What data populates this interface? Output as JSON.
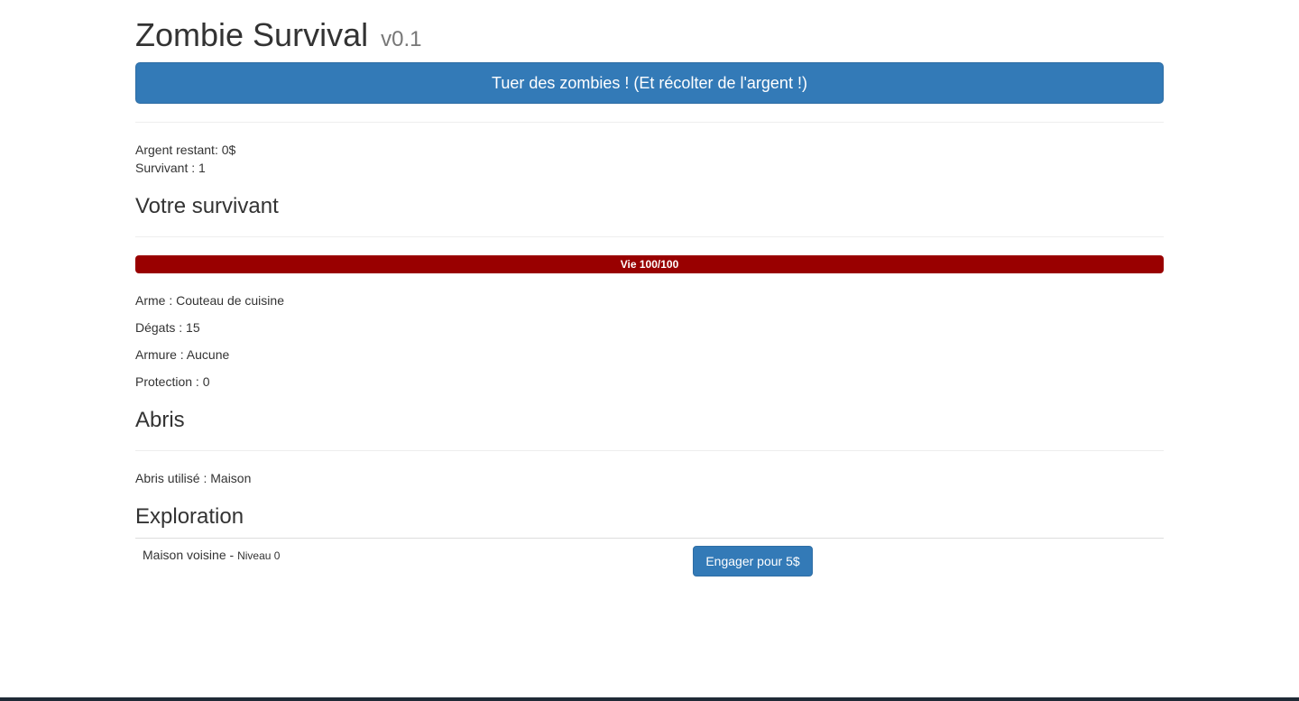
{
  "header": {
    "title": "Zombie Survival",
    "version": "v0.1"
  },
  "kill_button": {
    "label": "Tuer des zombies ! (Et récolter de l'argent !)"
  },
  "stats": {
    "money": "Argent restant: 0$",
    "survivors": "Survivant : 1"
  },
  "survivor": {
    "heading": "Votre survivant",
    "health": {
      "label": "Vie 100/100",
      "current": 100,
      "max": 100,
      "color": "#990000"
    },
    "weapon": "Arme : Couteau de cuisine",
    "damage": "Dégats : 15",
    "armor": "Armure : Aucune",
    "protection": "Protection : 0"
  },
  "shelter": {
    "heading": "Abris",
    "used": "Abris utilisé : Maison"
  },
  "exploration": {
    "heading": "Exploration",
    "rows": [
      {
        "name": "Maison voisine",
        "separator": " - ",
        "level": "Niveau 0",
        "button_label": "Engager pour 5$"
      }
    ]
  },
  "colors": {
    "primary": "#337ab7",
    "health": "#990000"
  }
}
